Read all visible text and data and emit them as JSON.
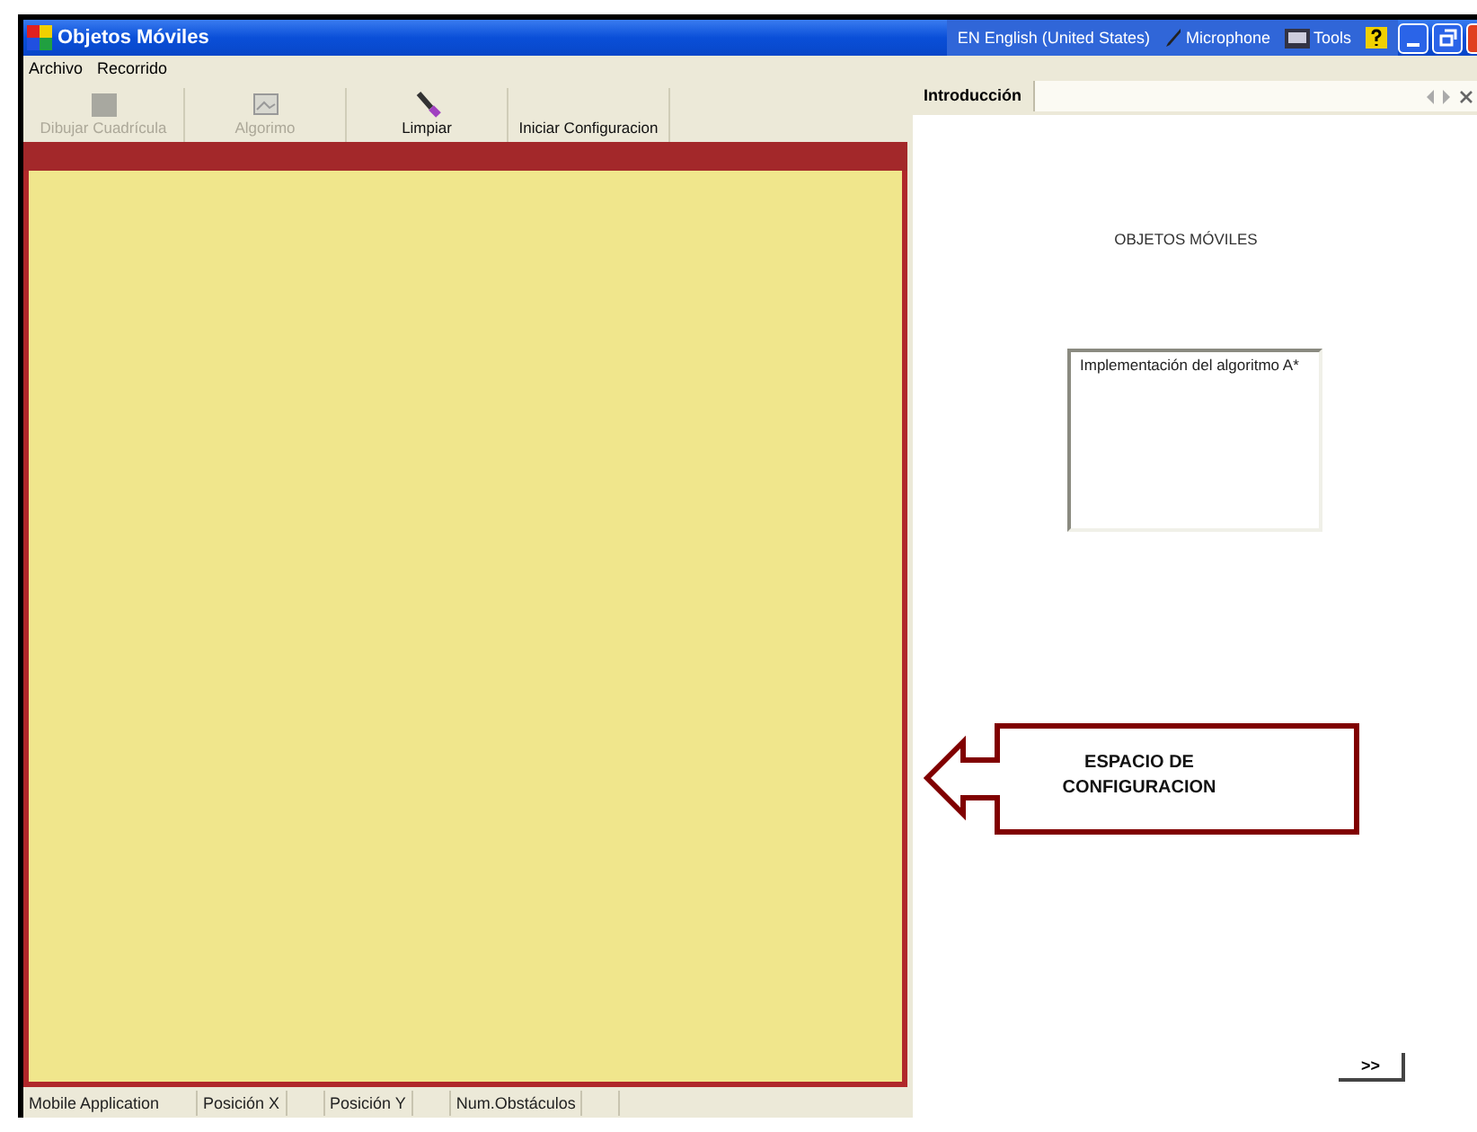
{
  "window": {
    "title": "Objetos Móviles"
  },
  "language_bar": {
    "language": "EN English (United States)",
    "items": [
      "Microphone",
      "Tools"
    ]
  },
  "menu": [
    "Archivo",
    "Recorrido"
  ],
  "toolbar": [
    {
      "label": "Dibujar Cuadrícula",
      "disabled": true
    },
    {
      "label": "Algorimo",
      "disabled": true
    },
    {
      "label": "Limpiar",
      "disabled": false
    },
    {
      "label": "Iniciar Configuracion",
      "disabled": false
    }
  ],
  "panel": {
    "tab": {
      "label": "Introducción",
      "selected": true
    },
    "heading": "OBJETOS MÓVILES",
    "textbox": "Implementación del algoritmo A*",
    "next_button": ">>"
  },
  "callout": {
    "text": "ESPACIO DE CONFIGURACION"
  },
  "status_bar": [
    "Mobile Application",
    "Posición X",
    "Posición Y",
    "Num.Obstáculos"
  ]
}
